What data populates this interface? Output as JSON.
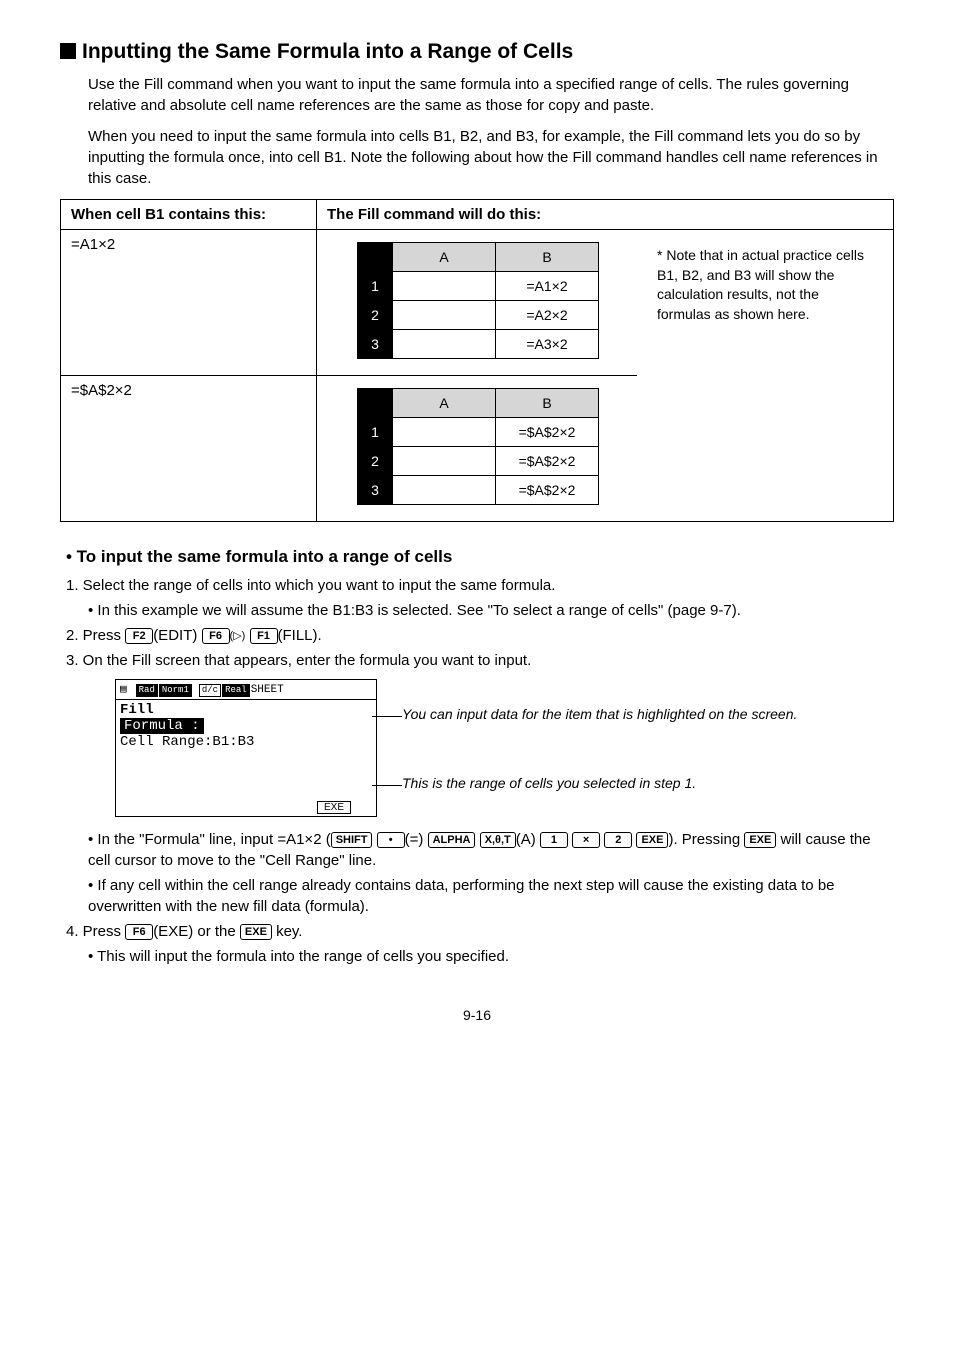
{
  "heading": "Inputting the Same Formula into a Range of Cells",
  "p1": "Use the Fill command when you want to input the same formula into a specified range of cells. The rules governing relative and absolute cell name references are the same as those for copy and paste.",
  "p2": "When you need to input the same formula into cells B1, B2, and B3, for example, the Fill command lets you do so by inputting the formula once, into cell B1. Note the following about how the Fill command handles cell name references in this case.",
  "th1": "When cell B1 contains this:",
  "th2": "The Fill command will do this:",
  "row1_a": "=A1×2",
  "row2_a": "=$A$2×2",
  "mini1": {
    "colA": "A",
    "colB": "B",
    "r1": "1",
    "r2": "2",
    "r3": "3",
    "b1": "=A1×2",
    "b2": "=A2×2",
    "b3": "=A3×2"
  },
  "mini2": {
    "colA": "A",
    "colB": "B",
    "r1": "1",
    "r2": "2",
    "r3": "3",
    "b1": "=$A$2×2",
    "b2": "=$A$2×2",
    "b3": "=$A$2×2"
  },
  "note": "* Note that in actual practice cells B1, B2, and B3 will show the calculation results, not the formulas as shown here.",
  "subhead": "• To input the same formula into a range of cells",
  "step1": "1. Select the range of cells into which you want to input the same formula.",
  "step1a": "• In this example we will assume the B1:B3 is selected. See \"To select a range of cells\" (page 9-7).",
  "step2_pre": "2. Press ",
  "step2_post": ".",
  "f2": "F2",
  "editlbl": "(EDIT)",
  "f6": "F6",
  "trilbl": "(▷)",
  "f1": "F1",
  "filllbl": "(FILL)",
  "step3": "3. On the Fill screen that appears, enter the formula you want to input.",
  "screen": {
    "tags": [
      "Rad",
      "Norm1",
      "d/c",
      "Real"
    ],
    "sheet": "SHEET",
    "fill": "Fill",
    "formula": "Formula   :",
    "range": "Cell Range:B1:B3",
    "exe": "EXE"
  },
  "call1": "You can input data for the item that is highlighted on the screen.",
  "call2": "This is the range of cells you selected in step 1.",
  "step3a_1": "• In the \"Formula\" line, input =A1×2 (",
  "keys": {
    "shift": "SHIFT",
    "dot": "•",
    "eq": "(=)",
    "alpha": "ALPHA",
    "xot": "X,θ,T",
    "A": "(A)",
    "k1": "1",
    "kx": "×",
    "k2": "2",
    "exe": "EXE"
  },
  "step3a_2": "). Pressing ",
  "step3a_3": " will cause the cell cursor to move to the \"Cell Range\" line.",
  "step3b": "• If any cell within the cell range already contains data, performing the next step will cause the existing data to be overwritten with the new fill data (formula).",
  "step4_1": "4. Press ",
  "step4_2": "(EXE) or the ",
  "step4_3": " key.",
  "step4a": "• This will input the formula into the range of cells you specified.",
  "pagenum": "9-16"
}
